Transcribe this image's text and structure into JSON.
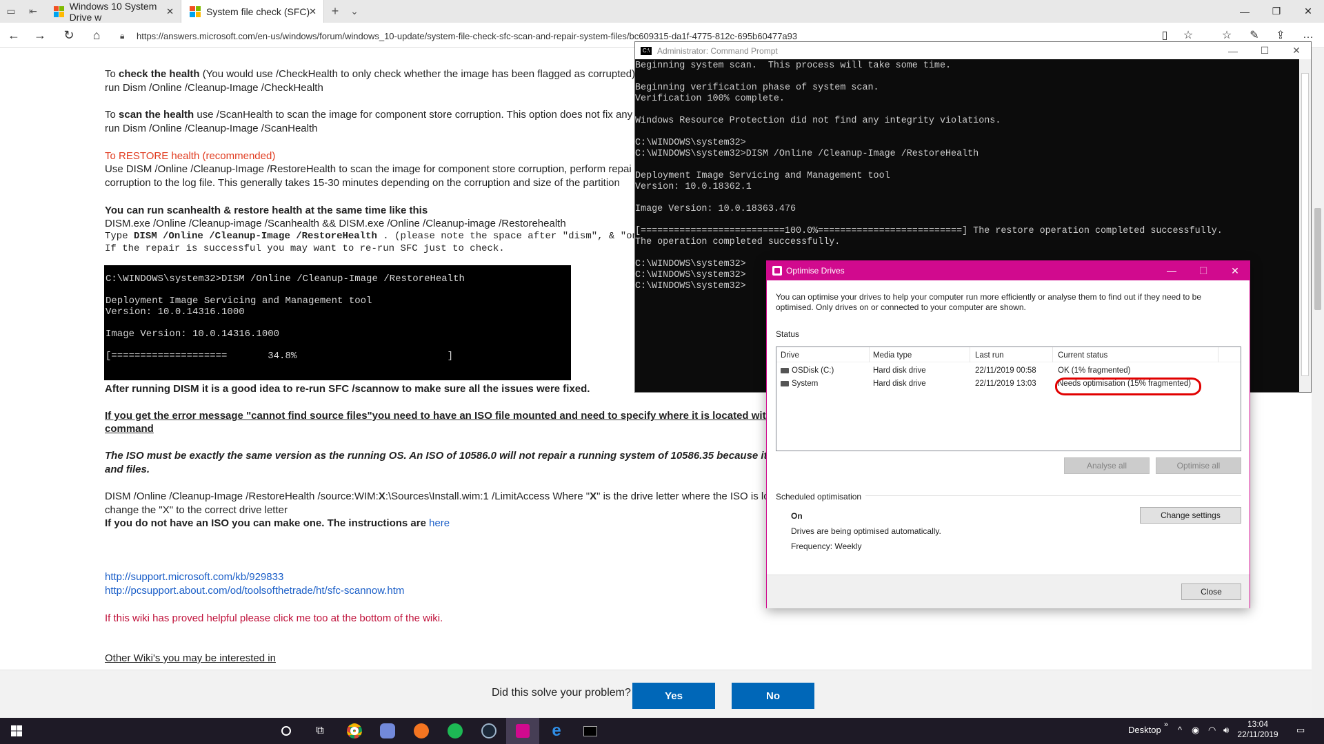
{
  "browser": {
    "tabs": [
      {
        "label": "Windows 10 System Drive w"
      },
      {
        "label": "System file check (SFC)"
      }
    ],
    "url": "https://answers.microsoft.com/en-us/windows/forum/windows_10-update/system-file-check-sfc-scan-and-repair-system-files/bc609315-da1f-4775-812c-695b60477a93"
  },
  "article": {
    "check_health_line1_pre": "To ",
    "check_health_bold": "check the health",
    "check_health_line1_post": " (You would use /CheckHealth to only check whether the image has been flagged as corrupted)",
    "check_health_line2": "run Dism /Online /Cleanup-Image /CheckHealth",
    "scan_health_pre": "To ",
    "scan_health_bold": "scan the health",
    "scan_health_post": " use /ScanHealth to scan the image for component store corruption. This option does not fix any c",
    "scan_health_line2": "run Dism /Online /Cleanup-Image /ScanHealth",
    "restore_heading": "To RESTORE health (recommended)",
    "restore_line1": "Use DISM /Online /Cleanup-Image /RestoreHealth to scan the image for component store corruption, perform repai",
    "restore_line2": "corruption to the log file.  This generally takes 15-30 minutes depending on the corruption and size of the partition",
    "same_time_heading": "You can run scanhealth & restore health at the same time like this",
    "same_time_cmd": "DISM.exe /Online /Cleanup-image /Scanhealth && DISM.exe /Online /Cleanup-image /Restorehealth",
    "type_line_pre": "Type ",
    "type_line_bold": "DISM /Online /Cleanup-Image /RestoreHealth",
    "type_line_post": " .  (please note the space after \"dism\", & \"on",
    "repair_line": "If the repair is successful you may want to re-run SFC just to check.",
    "code_block": "C:\\WINDOWS\\system32>DISM /Online /Cleanup-Image /RestoreHealth\n\nDeployment Image Servicing and Management tool\nVersion: 10.0.14316.1000\n\nImage Version: 10.0.14316.1000\n\n[====================       34.8%                          ]",
    "after_dism": "After running DISM it is a good idea to re-run SFC /scannow to make sure all the issues were fixed.",
    "error_line1": "If you get the error message \"cannot find source files\"you need to have an ISO file mounted and need to specify where it is located with the b",
    "error_line2": "command",
    "iso_line1": "The ISO must be exactly the same version as the running OS.  An ISO of 10586.0 will not repair a running system of 10586.35 because it has ada",
    "iso_line2": "and files.",
    "dism_source_pre": "DISM /Online /Cleanup-Image /RestoreHealth /source:WIM:",
    "dism_source_bold_x": "X",
    "dism_source_post": ":\\Sources\\Install.wim:1 /LimitAccess  Where \"",
    "dism_source_bold_x2": "X",
    "dism_source_post2": "\" is the drive letter where the ISO is lo",
    "change_x": "change the \"X\" to the correct drive letter",
    "no_iso": "If you do not have an ISO you can make one.  The instructions are ",
    "here": "here",
    "link1": "http://support.microsoft.com/kb/929833",
    "link2": "http://pcsupport.about.com/od/toolsofthetrade/ht/sfc-scannow.htm",
    "helpful": "If this wiki has proved helpful please click me too at the bottom of the wiki.",
    "other_wikis": "Other Wiki's you may be interested in"
  },
  "feedback": {
    "question": "Did this solve your problem?",
    "yes": "Yes",
    "no": "No"
  },
  "cmd": {
    "title": "Administrator: Command Prompt",
    "output": "Beginning system scan.  This process will take some time.\n\nBeginning verification phase of system scan.\nVerification 100% complete.\n\nWindows Resource Protection did not find any integrity violations.\n\nC:\\WINDOWS\\system32>\nC:\\WINDOWS\\system32>DISM /Online /Cleanup-Image /RestoreHealth\n\nDeployment Image Servicing and Management tool\nVersion: 10.0.18362.1\n\nImage Version: 10.0.18363.476\n\n[==========================100.0%==========================] The restore operation completed successfully.\nThe operation completed successfully.\n\nC:\\WINDOWS\\system32>\nC:\\WINDOWS\\system32>\nC:\\WINDOWS\\system32>"
  },
  "optimise": {
    "title": "Optimise Drives",
    "description": "You can optimise your drives to help your computer run more efficiently or analyse them to find out if they need to be optimised. Only drives on or connected to your computer are shown.",
    "status_label": "Status",
    "columns": [
      "Drive",
      "Media type",
      "Last run",
      "Current status"
    ],
    "rows": [
      {
        "drive": "OSDisk (C:)",
        "media": "Hard disk drive",
        "last_run": "22/11/2019 00:58",
        "status": "OK (1% fragmented)"
      },
      {
        "drive": "System",
        "media": "Hard disk drive",
        "last_run": "22/11/2019 13:03",
        "status": "Needs optimisation (15% fragmented)"
      }
    ],
    "analyse_all": "Analyse all",
    "optimise_all": "Optimise all",
    "scheduled_label": "Scheduled optimisation",
    "scheduled_state": "On",
    "scheduled_desc": "Drives are being optimised automatically.",
    "frequency": "Frequency: Weekly",
    "change_settings": "Change settings",
    "close": "Close"
  },
  "taskbar": {
    "desktop": "Desktop",
    "time": "13:04",
    "date": "22/11/2019"
  },
  "colors": {
    "accent_pink": "#d10a8e",
    "highlight_red": "#e10000",
    "feedback_blue": "#0067b8",
    "link_blue": "#1a5ec8"
  }
}
